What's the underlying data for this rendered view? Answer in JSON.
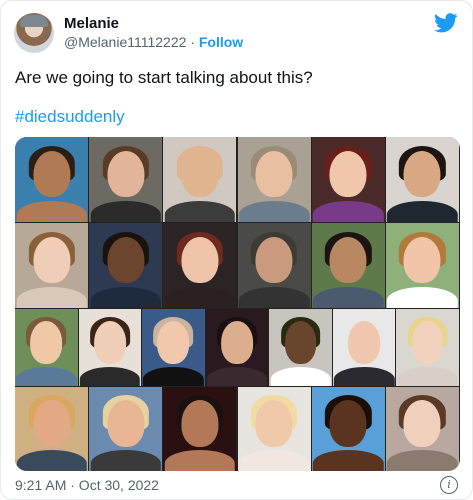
{
  "author": {
    "name": "Melanie",
    "handle": "@Melanie11112222",
    "separator": "·",
    "follow_label": "Follow"
  },
  "tweet": {
    "text": "Are we going to start talking about this?",
    "hashtag": "#diedsuddenly"
  },
  "footer": {
    "timestamp": "9:21 AM · Oct 30, 2022",
    "info_glyph": "i"
  },
  "icons": {
    "platform": "twitter-bird-icon",
    "info": "info-icon"
  },
  "colors": {
    "accent": "#1d9bf0",
    "text": "#0f1419",
    "muted": "#536471"
  },
  "media": {
    "rows": [
      [
        {
          "bg": "#3a7fae",
          "skin": "#b07a55",
          "hair": "#2a1e16",
          "top": "#b07a55"
        },
        {
          "bg": "#6d6a63",
          "skin": "#e2b59a",
          "hair": "#5a3b28",
          "top": "#2b2b2b"
        },
        {
          "bg": "#cfc9c2",
          "skin": "#e0b48f",
          "hair": "#e0b48f",
          "top": "#3c3c3c"
        },
        {
          "bg": "#a9a294",
          "skin": "#e9bfa1",
          "hair": "#9a8a76",
          "top": "#6b7d8c"
        },
        {
          "bg": "#4b2a2a",
          "skin": "#f1c6ab",
          "hair": "#6b1f1a",
          "top": "#7a3a8a"
        },
        {
          "bg": "#d9d4cf",
          "skin": "#d8a885",
          "hair": "#1e1510",
          "top": "#1f2733"
        }
      ],
      [
        {
          "bg": "#b8a898",
          "skin": "#f0cdb6",
          "hair": "#8a5f3a",
          "top": "#d9c8b8"
        },
        {
          "bg": "#2d3a52",
          "skin": "#6b452e",
          "hair": "#1a120c",
          "top": "#1e2a40"
        },
        {
          "bg": "#2c2424",
          "skin": "#f0c4aa",
          "hair": "#6e2a1e",
          "top": "#2d2020"
        },
        {
          "bg": "#4a4a46",
          "skin": "#c99a7e",
          "hair": "#3e3a36",
          "top": "#333"
        },
        {
          "bg": "#5f7a4a",
          "skin": "#b98863",
          "hair": "#1c1410",
          "top": "#4c5a70"
        },
        {
          "bg": "#8fb07a",
          "skin": "#f2c5a8",
          "hair": "#b07a3a",
          "top": "#ffffff"
        }
      ],
      [
        {
          "bg": "#6f8f5a",
          "skin": "#f0c8a6",
          "hair": "#7a5a3a",
          "top": "#5a7a9a"
        },
        {
          "bg": "#e8e0d8",
          "skin": "#f0cfb8",
          "hair": "#3a2418",
          "top": "#2a2a2a"
        },
        {
          "bg": "#3a5a8a",
          "skin": "#f2c8ac",
          "hair": "#c8b4a0",
          "top": "#111111"
        },
        {
          "bg": "#2a1a20",
          "skin": "#dcae8e",
          "hair": "#1a1010",
          "top": "#3a2a30"
        },
        {
          "bg": "#c8c4be",
          "skin": "#6a452e",
          "hair": "#2a2a10",
          "top": "#ffffff"
        },
        {
          "bg": "#e8e8e8",
          "skin": "#f0c6ae",
          "hair": "#e8e8e8",
          "top": "#2a2a30"
        },
        {
          "bg": "#dad6d0",
          "skin": "#f2d2bc",
          "hair": "#e8d48a",
          "top": "#d8d0c8"
        }
      ],
      [
        {
          "bg": "#cfb080",
          "skin": "#e2aa84",
          "hair": "#d8a860",
          "top": "#3a4a5a"
        },
        {
          "bg": "#6a8ab0",
          "skin": "#e8b694",
          "hair": "#e6d2a0",
          "top": "#3a3a3a"
        },
        {
          "bg": "#2a1010",
          "skin": "#b27858",
          "hair": "#1a1210",
          "top": "#b27858"
        },
        {
          "bg": "#e8e4e0",
          "skin": "#f0c8aa",
          "hair": "#f0dca0",
          "top": "#f0e8e0"
        },
        {
          "bg": "#5aa0d8",
          "skin": "#5a3420",
          "hair": "#1a0e08",
          "top": "#5a3420"
        },
        {
          "bg": "#b8a8a0",
          "skin": "#f0d0bc",
          "hair": "#5a3a24",
          "top": "#8a7a70"
        }
      ]
    ]
  }
}
